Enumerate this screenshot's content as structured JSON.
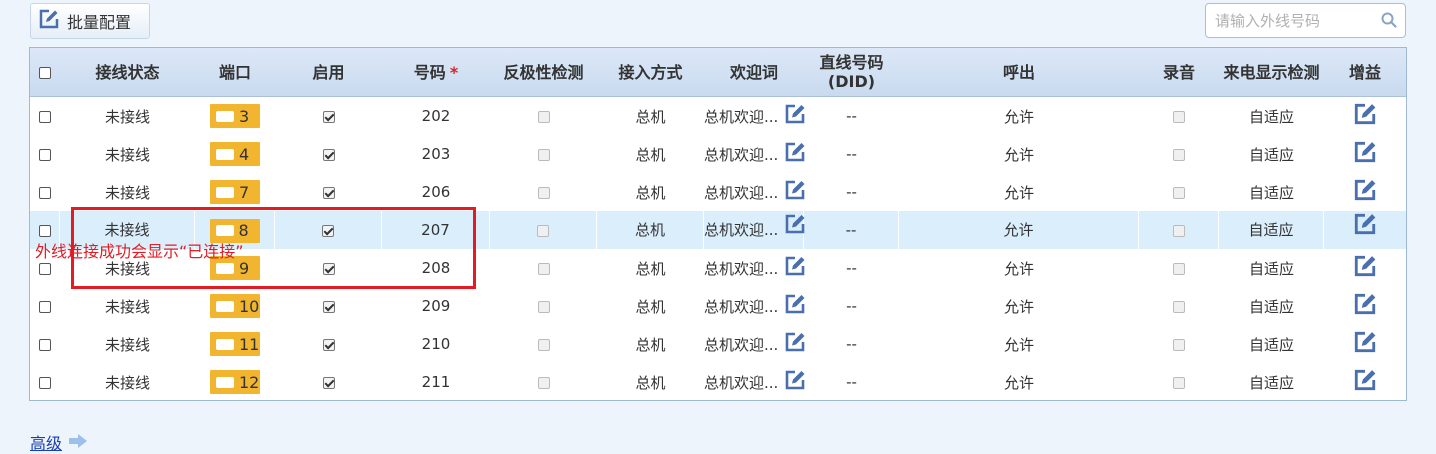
{
  "toolbar": {
    "batch_config_label": "批量配置"
  },
  "search": {
    "placeholder": "请输入外线号码",
    "value": ""
  },
  "table": {
    "headers": {
      "status": "接线状态",
      "port": "端口",
      "enabled": "启用",
      "number": "号码",
      "number_required": "*",
      "polarity": "反极性检测",
      "access": "接入方式",
      "welcome": "欢迎词",
      "did_line1": "直线号码",
      "did_line2": "(DID)",
      "outbound": "呼出",
      "record": "录音",
      "callerid": "来电显示检测",
      "gain": "增益"
    },
    "rows": [
      {
        "status": "未接线",
        "port": "3",
        "enabled": true,
        "number": "202",
        "polarity": false,
        "access": "总机",
        "welcome": "总机欢迎...",
        "did": "--",
        "outbound": "允许",
        "record": false,
        "callerid": "自适应"
      },
      {
        "status": "未接线",
        "port": "4",
        "enabled": true,
        "number": "203",
        "polarity": false,
        "access": "总机",
        "welcome": "总机欢迎...",
        "did": "--",
        "outbound": "允许",
        "record": false,
        "callerid": "自适应"
      },
      {
        "status": "未接线",
        "port": "7",
        "enabled": true,
        "number": "206",
        "polarity": false,
        "access": "总机",
        "welcome": "总机欢迎...",
        "did": "--",
        "outbound": "允许",
        "record": false,
        "callerid": "自适应"
      },
      {
        "status": "未接线",
        "port": "8",
        "enabled": true,
        "number": "207",
        "polarity": false,
        "access": "总机",
        "welcome": "总机欢迎...",
        "did": "--",
        "outbound": "允许",
        "record": false,
        "callerid": "自适应"
      },
      {
        "status": "未接线",
        "port": "9",
        "enabled": true,
        "number": "208",
        "polarity": false,
        "access": "总机",
        "welcome": "总机欢迎...",
        "did": "--",
        "outbound": "允许",
        "record": false,
        "callerid": "自适应"
      },
      {
        "status": "未接线",
        "port": "10",
        "enabled": true,
        "number": "209",
        "polarity": false,
        "access": "总机",
        "welcome": "总机欢迎...",
        "did": "--",
        "outbound": "允许",
        "record": false,
        "callerid": "自适应"
      },
      {
        "status": "未接线",
        "port": "11",
        "enabled": true,
        "number": "210",
        "polarity": false,
        "access": "总机",
        "welcome": "总机欢迎...",
        "did": "--",
        "outbound": "允许",
        "record": false,
        "callerid": "自适应"
      },
      {
        "status": "未接线",
        "port": "12",
        "enabled": true,
        "number": "211",
        "polarity": false,
        "access": "总机",
        "welcome": "总机欢迎...",
        "did": "--",
        "outbound": "允许",
        "record": false,
        "callerid": "自适应"
      }
    ]
  },
  "annotation": {
    "text": "外线连接成功会显示“已连接”"
  },
  "footer": {
    "advanced_label": "高级"
  },
  "colors": {
    "accent": "#4a6fae",
    "port_badge": "#f1b52f",
    "highlight_row": "#dbeefc",
    "annotation": "#e31b23",
    "link": "#1a3fb5"
  },
  "icons": {
    "batch": "edit-icon",
    "search": "search-icon",
    "welcome_edit": "edit-icon",
    "gain_edit": "edit-icon",
    "advanced": "arrow-right-icon"
  }
}
